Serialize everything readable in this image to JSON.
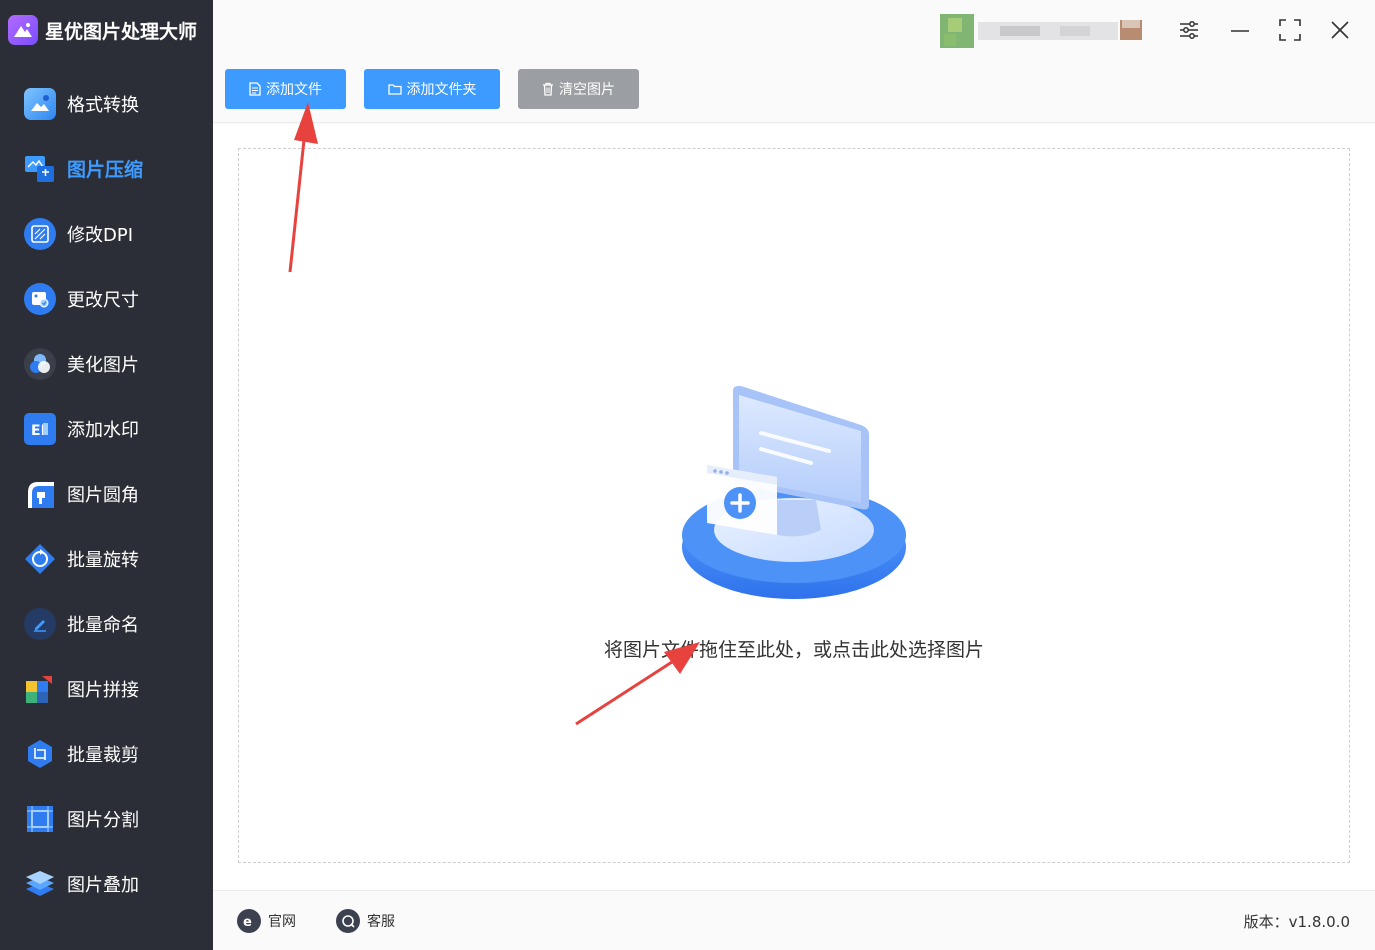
{
  "app": {
    "title": "星优图片处理大师"
  },
  "sidebar": {
    "items": [
      {
        "label": "格式转换",
        "icon": "image-convert-icon",
        "active": false
      },
      {
        "label": "图片压缩",
        "icon": "image-compress-icon",
        "active": true
      },
      {
        "label": "修改DPI",
        "icon": "dpi-icon",
        "active": false
      },
      {
        "label": "更改尺寸",
        "icon": "resize-icon",
        "active": false
      },
      {
        "label": "美化图片",
        "icon": "beautify-icon",
        "active": false
      },
      {
        "label": "添加水印",
        "icon": "watermark-icon",
        "active": false
      },
      {
        "label": "图片圆角",
        "icon": "rounded-corner-icon",
        "active": false
      },
      {
        "label": "批量旋转",
        "icon": "rotate-icon",
        "active": false
      },
      {
        "label": "批量命名",
        "icon": "rename-icon",
        "active": false
      },
      {
        "label": "图片拼接",
        "icon": "stitch-icon",
        "active": false
      },
      {
        "label": "批量裁剪",
        "icon": "crop-icon",
        "active": false
      },
      {
        "label": "图片分割",
        "icon": "split-icon",
        "active": false
      },
      {
        "label": "图片叠加",
        "icon": "layers-icon",
        "active": false
      }
    ]
  },
  "toolbar": {
    "add_file": "添加文件",
    "add_folder": "添加文件夹",
    "clear_images": "清空图片"
  },
  "main": {
    "drop_hint": "将图片文件拖住至此处，或点击此处选择图片"
  },
  "footer": {
    "website": "官网",
    "support": "客服",
    "version": "版本：v1.8.0.0"
  },
  "colors": {
    "sidebar_bg": "#2b2e36",
    "accent": "#3d9bff",
    "gray_button": "#9b9ea3",
    "annotation_arrow": "#e8423f"
  }
}
